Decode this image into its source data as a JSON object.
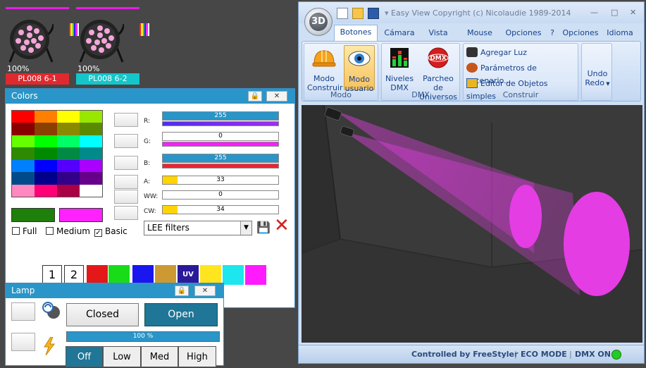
{
  "fixtures": [
    {
      "pct": "100%",
      "name": "PL008 6-1",
      "name_bg": "#e0292f"
    },
    {
      "pct": "100%",
      "name": "PL008 6-2",
      "name_bg": "#14c6c9"
    }
  ],
  "colors_panel": {
    "title": "Colors",
    "sliders": [
      {
        "label": "R:",
        "value": "255",
        "fill": "#2a95c8",
        "line": "#4d2ef0"
      },
      {
        "label": "G:",
        "value": "0",
        "fill": "#ffffff",
        "line": "#ff1cff"
      },
      {
        "label": "B:",
        "value": "255",
        "fill": "#2a95c8",
        "line": "#ee2233"
      },
      {
        "label": "A:",
        "value": "33",
        "level": 0.13,
        "fill": "#ffd400"
      },
      {
        "label": "WW:",
        "value": "0",
        "level": 0.0,
        "fill": "#ffd400"
      },
      {
        "label": "CW:",
        "value": "34",
        "level": 0.13,
        "fill": "#ffd400"
      }
    ],
    "previews": [
      "#1f7f0b",
      "#ff22ff"
    ],
    "checkboxes": [
      {
        "label": "Full",
        "checked": false
      },
      {
        "label": "Medium",
        "checked": false
      },
      {
        "label": "Basic",
        "checked": true
      }
    ],
    "filter_select": "LEE filters",
    "numbers": [
      "1",
      "2"
    ],
    "quick_colors": [
      "#e41818",
      "#19dc19",
      "#1a16f0",
      "#cc9933",
      "#2a1a9a",
      "#ffe51e",
      "#1ee6ee",
      "#ff1aff"
    ],
    "uv_label": "UV",
    "swatches": [
      "#ff0000",
      "#ff7f00",
      "#ffff00",
      "#99e600",
      "#8a0000",
      "#8a4000",
      "#8a8a00",
      "#5a8a00",
      "#66ff00",
      "#00ff00",
      "#00ff66",
      "#00ffff",
      "#2e8a00",
      "#008a00",
      "#008a44",
      "#008a8a",
      "#007fff",
      "#0000ff",
      "#5500ff",
      "#aa00ff",
      "#004a8a",
      "#00008a",
      "#33008a",
      "#66008a",
      "#ff88c0",
      "#ff0077",
      "#aa0044",
      "#ffffff"
    ]
  },
  "lamp_panel": {
    "title": "Lamp",
    "closed_label": "Closed",
    "open_label": "Open",
    "progress_label": "100 %",
    "progress": 1.0,
    "levels": [
      "Off",
      "Low",
      "Med",
      "High"
    ]
  },
  "app": {
    "orb_label": "3D",
    "title": "Easy View   Copyright (c) Nicolaudie 1989-2014",
    "tabs": [
      "Botones es",
      "Cámara",
      "Vista",
      "Mouse",
      "Opciones (",
      "?",
      "Opciones",
      "Idioma"
    ],
    "groups": {
      "modo": {
        "title": "Modo",
        "btn1": "Modo Construir",
        "btn2": "Modo usuario"
      },
      "dmx": {
        "title": "DMX",
        "btn1": "Niveles DMX",
        "btn2": "Parcheo de Universos",
        "dmx_logo": "DMX"
      },
      "construir": {
        "title": "Construir",
        "items": [
          "Agregar Luz",
          "Parámetros de escenario...",
          "Editor de Objetos simples"
        ]
      },
      "undo": {
        "label": "Undo Redo"
      }
    },
    "status": {
      "left": "Controlled by FreeStyler",
      "mid": "ECO MODE",
      "right": "DMX ON",
      "indicator_color": "#22cc22"
    }
  },
  "colors": {
    "accent": "#2a95c8",
    "beam": "#e43de4"
  }
}
